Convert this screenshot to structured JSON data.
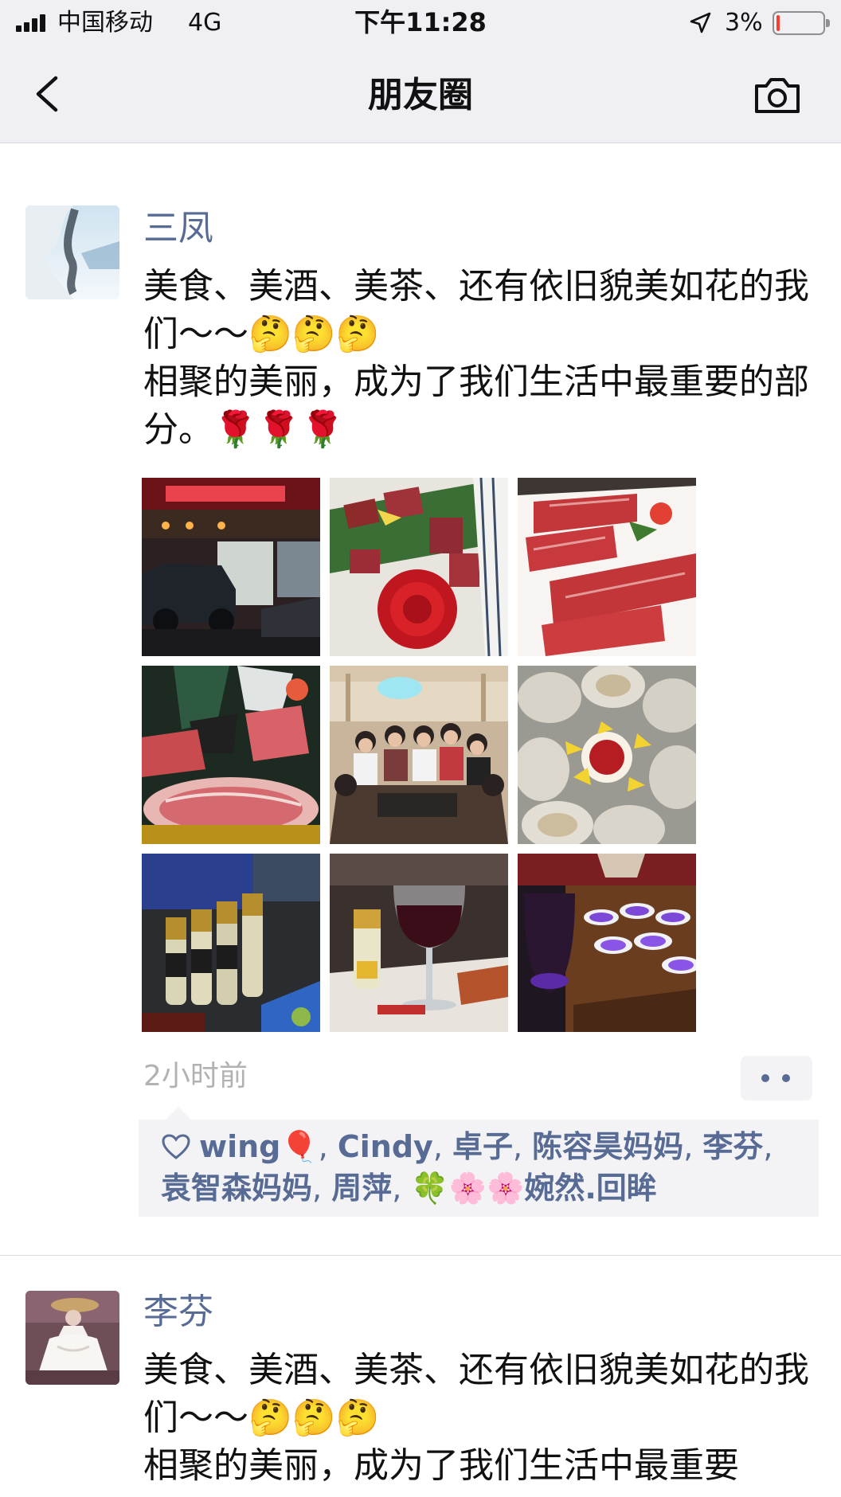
{
  "status_bar": {
    "carrier": "中国移动",
    "network": "4G",
    "time": "下午11:28",
    "battery_percent": "3%",
    "battery_level": 0.03,
    "icons": [
      "signal-icon",
      "location-arrow-icon",
      "battery-icon"
    ]
  },
  "nav": {
    "title": "朋友圈",
    "back_icon": "chevron-left-icon",
    "camera_icon": "camera-icon"
  },
  "posts": [
    {
      "author": "三凤",
      "text": "美食、美酒、美茶、还有依旧貌美如花的我们～～🤔🤔🤔\n相聚的美丽，成为了我们生活中最重要的部分。🌹🌹🌹",
      "photos": [
        "restaurant-storefront-photo",
        "marbled-beef-rose-photo",
        "sliced-beef-platter-photo",
        "beef-display-photo",
        "group-dinner-photo",
        "oysters-photo",
        "bottles-photo",
        "red-wine-glass-photo",
        "tea-cups-photo"
      ],
      "time": "2小时前",
      "likes_icon": "heart-outline-icon",
      "likes": [
        "wing🎈",
        "Cindy",
        "卓子",
        "陈容昊妈妈",
        "李芬",
        "袁智森妈妈",
        "周萍",
        "🍀🌸🌸婉然.回眸"
      ]
    },
    {
      "author": "李芬",
      "text": "美食、美酒、美茶、还有依旧貌美如花的我们～～🤔🤔🤔\n相聚的美丽，成为了我们生活中最重要"
    }
  ],
  "colors": {
    "nav_background": "#efeff4",
    "link_blue": "#576b95",
    "timestamp_gray": "#b2b2b2",
    "likes_background": "#f3f3f5"
  }
}
